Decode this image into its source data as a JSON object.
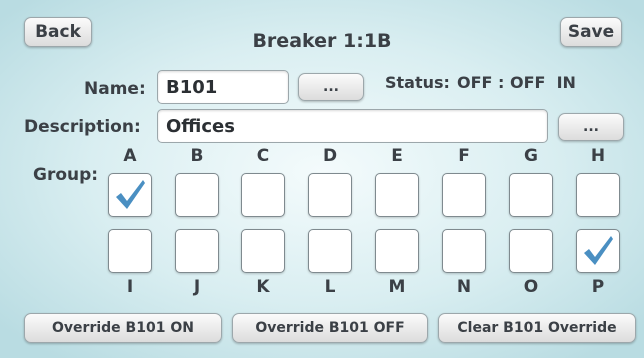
{
  "header": {
    "title": "Breaker 1:1B",
    "back_label": "Back",
    "save_label": "Save"
  },
  "name": {
    "label": "Name:",
    "value": "B101",
    "browse_label": "..."
  },
  "status": {
    "label": "Status:",
    "value": "OFF : OFF  IN"
  },
  "description": {
    "label": "Description:",
    "value": "Offices",
    "browse_label": "..."
  },
  "group": {
    "label": "Group:",
    "top_row": [
      {
        "letter": "A",
        "checked": true
      },
      {
        "letter": "B",
        "checked": false
      },
      {
        "letter": "C",
        "checked": false
      },
      {
        "letter": "D",
        "checked": false
      },
      {
        "letter": "E",
        "checked": false
      },
      {
        "letter": "F",
        "checked": false
      },
      {
        "letter": "G",
        "checked": false
      },
      {
        "letter": "H",
        "checked": false
      }
    ],
    "bottom_row": [
      {
        "letter": "I",
        "checked": false
      },
      {
        "letter": "J",
        "checked": false
      },
      {
        "letter": "K",
        "checked": false
      },
      {
        "letter": "L",
        "checked": false
      },
      {
        "letter": "M",
        "checked": false
      },
      {
        "letter": "N",
        "checked": false
      },
      {
        "letter": "O",
        "checked": false
      },
      {
        "letter": "P",
        "checked": true
      }
    ]
  },
  "actions": {
    "override_on": "Override B101 ON",
    "override_off": "Override B101 OFF",
    "clear_override": "Clear B101 Override"
  },
  "colors": {
    "checkmark": "#4a8fc2"
  }
}
